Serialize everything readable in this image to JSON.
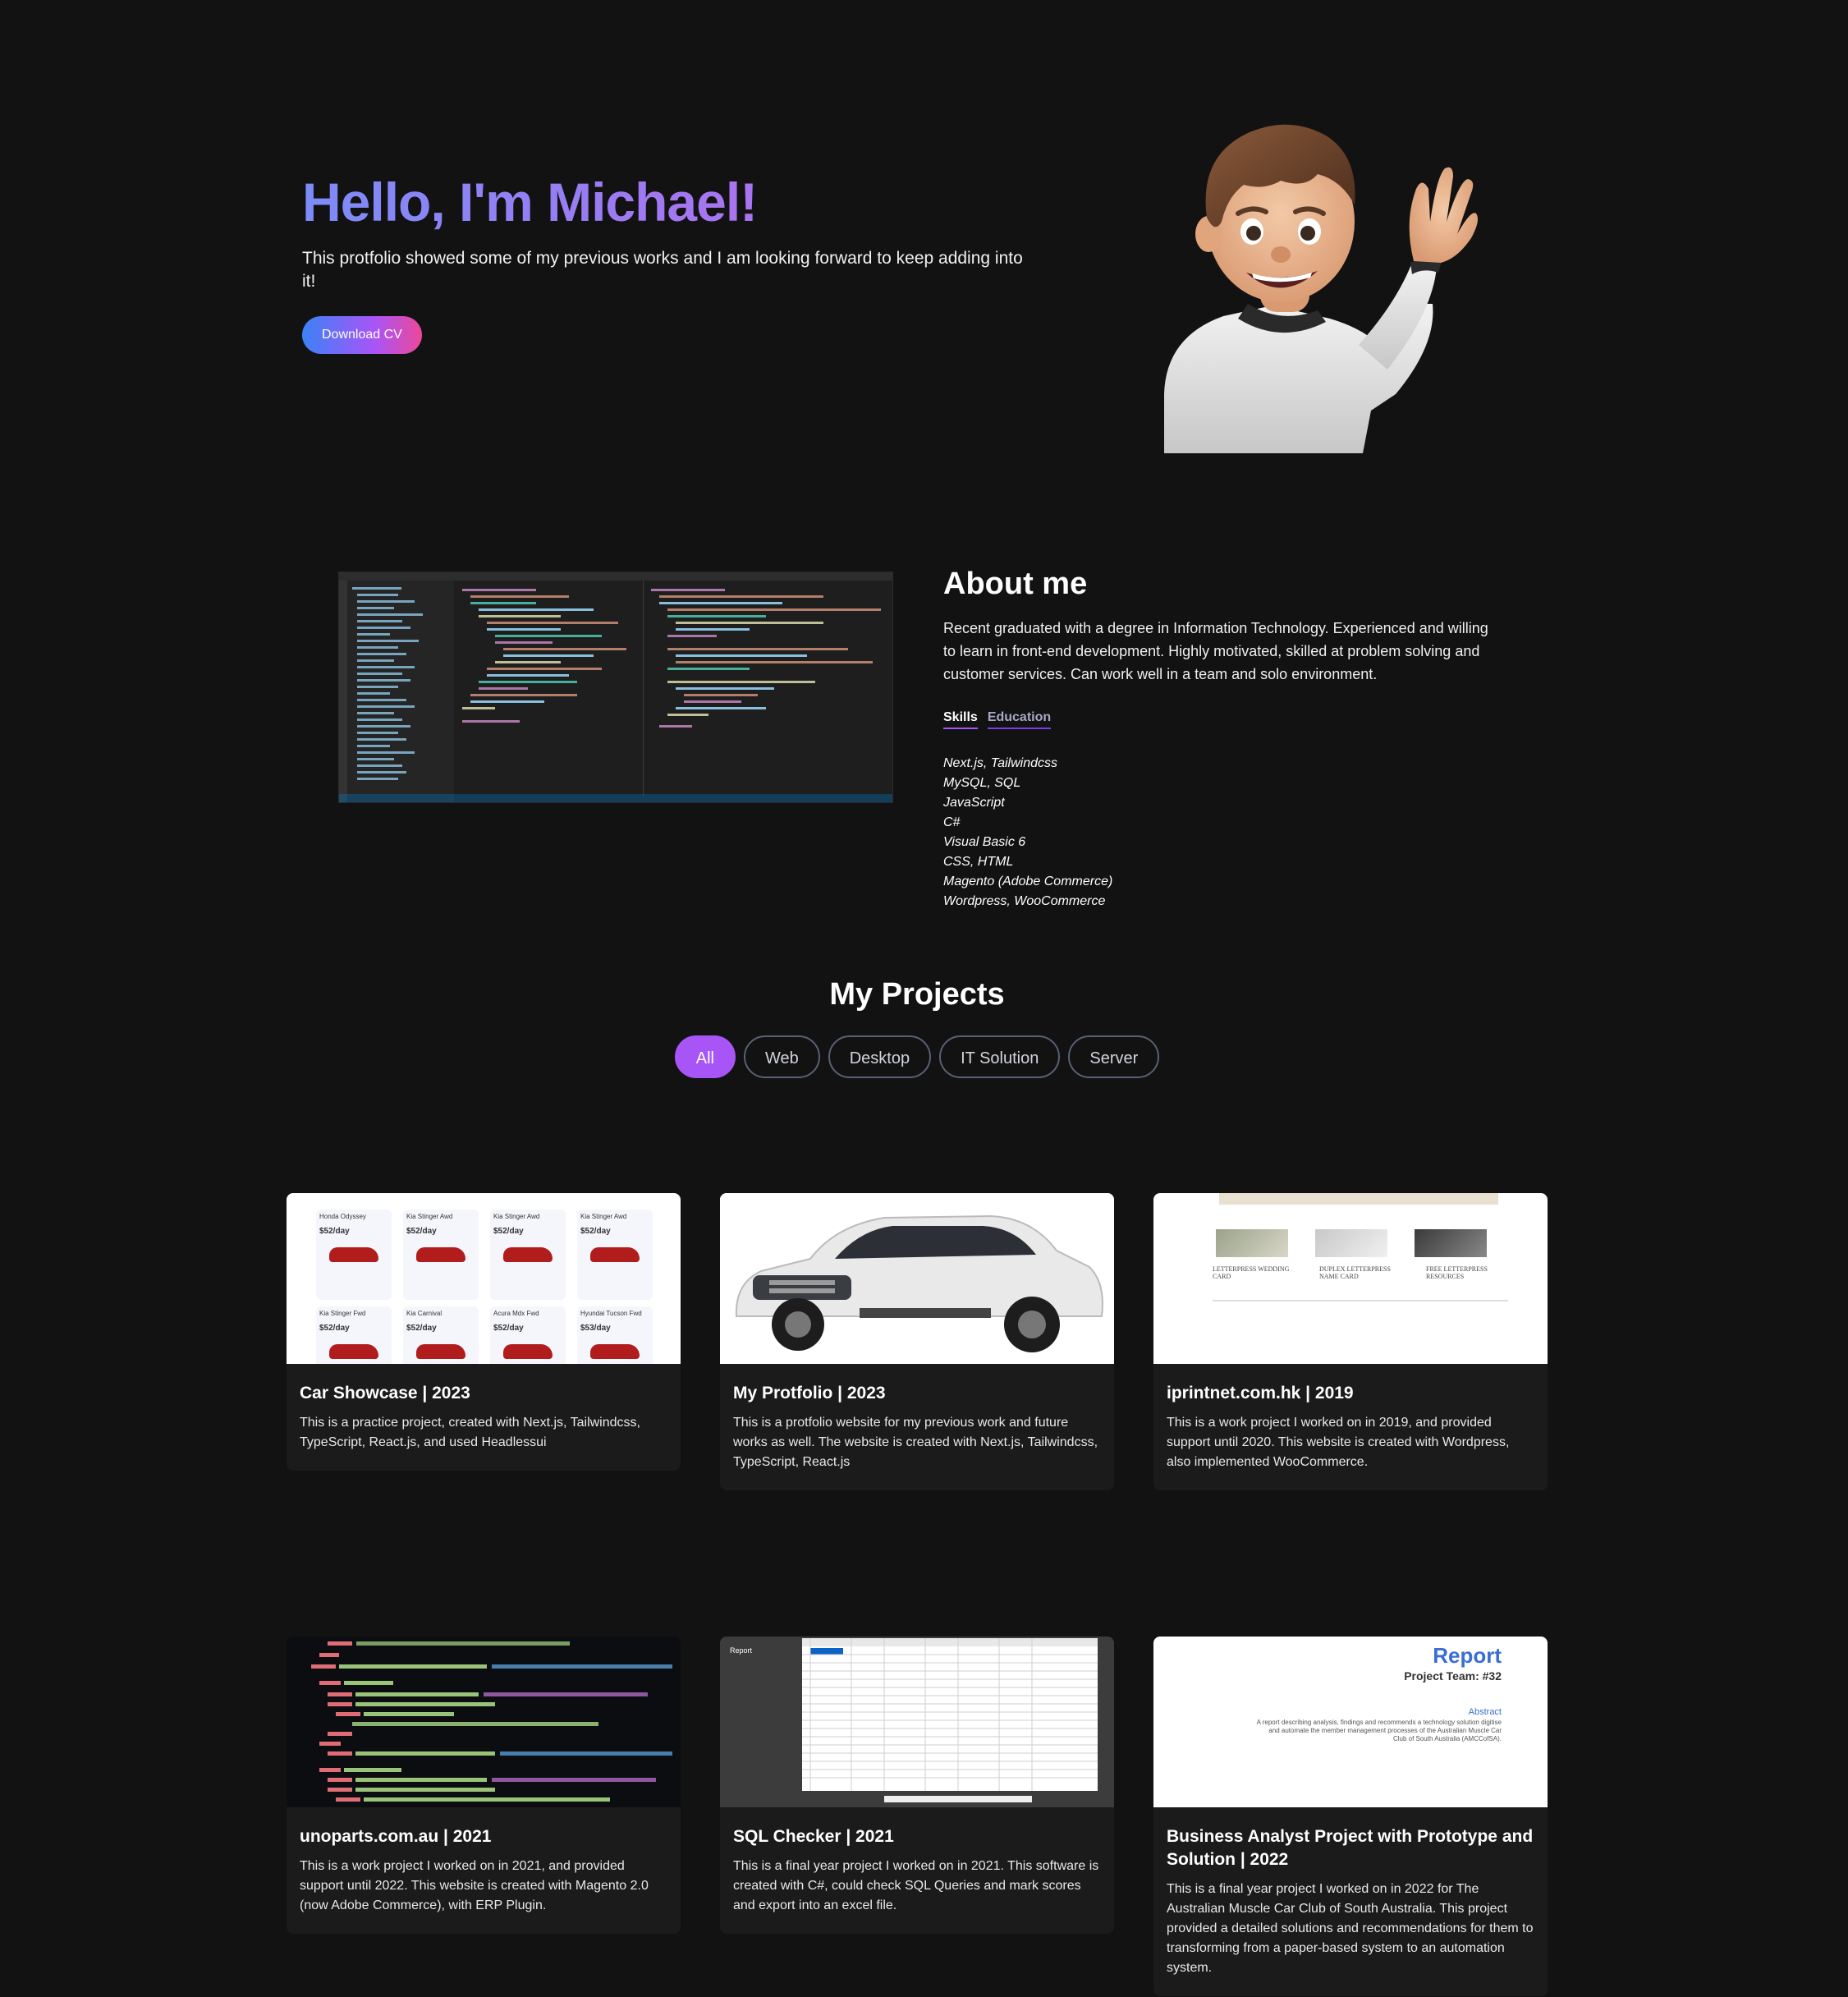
{
  "hero": {
    "title": "Hello, I'm Michael!",
    "description": "This protfolio showed some of my previous works and I am looking forward to keep adding into it!",
    "cta_label": "Download CV"
  },
  "about": {
    "title": "About me",
    "description": "Recent graduated with a degree in Information Technology. Experienced and willing to learn in front-end development. Highly motivated, skilled at problem solving and customer services. Can work well in a team and solo environment.",
    "tabs": [
      "Skills",
      "Education"
    ],
    "skills": [
      "Next.js, Tailwindcss",
      "MySQL, SQL",
      "JavaScript",
      "C#",
      "Visual Basic 6",
      "CSS, HTML",
      "Magento (Adobe Commerce)",
      "Wordpress, WooCommerce"
    ]
  },
  "projects": {
    "title": "My Projects",
    "filters": [
      "All",
      "Web",
      "Desktop",
      "IT Solution",
      "Server"
    ],
    "items": [
      {
        "title": "Car Showcase | 2023",
        "description": "This is a practice project, created with Next.js, Tailwindcss, TypeScript, React.js, and used Headlessui"
      },
      {
        "title": "My Protfolio | 2023",
        "description": "This is a protfolio website for my previous work and future works as well. The website is created with Next.js, Tailwindcss, TypeScript, React.js"
      },
      {
        "title": "iprintnet.com.hk | 2019",
        "description": "This is a work project I worked on in 2019, and provided support until 2020. This website is created with Wordpress, also implemented WooCommerce."
      },
      {
        "title": "unoparts.com.au | 2021",
        "description": "This is a work project I worked on in 2021, and provided support until 2022. This website is created with Magento 2.0 (now Adobe Commerce), with ERP Plugin."
      },
      {
        "title": "SQL Checker | 2021",
        "description": "This is a final year project I worked on in 2021. This software is created with C#, could check SQL Queries and mark scores and export into an excel file."
      },
      {
        "title": "Business Analyst Project with Prototype and Solution | 2022",
        "description": "This is a final year project I worked on in 2022 for The Australian Muscle Car Club of South Australia. This project provided a detailed solutions and recommendations for them to transforming from a paper-based system to an automation system."
      }
    ],
    "thumb_text": {
      "cars": [
        "Honda Odyssey",
        "Kia Stinger Awd",
        "Kia Stinger Awd",
        "Kia Stinger Awd",
        "Kia Stinger Fwd",
        "Kia Carnival",
        "Acura Mdx Fwd",
        "Hyundai Tucson Fwd"
      ],
      "car_prices": [
        "$52/day",
        "$52/day",
        "$52/day",
        "$52/day",
        "$52/day",
        "$52/day",
        "$52/day",
        "$53/day"
      ],
      "print_cols": [
        "LETTERPRESS WEDDING CARD",
        "DUPLEX LETTERPRESS NAME CARD",
        "FREE LETTERPRESS RESOURCES"
      ],
      "report_title": "Report",
      "report_team": "Project Team: #32",
      "report_abstract": "Abstract",
      "report_body": "A report describing analysis, findings and recommends a technology solution digitise and automate the member management processes of the Australian Muscle Car Club of South Australia (AMCCofSA).",
      "sql_side": "Report"
    }
  },
  "colors": {
    "background": "#121212",
    "card": "#1b1b1b",
    "accent": "#a855f7",
    "title_gradient": [
      "#7c8cf8",
      "#c06ee8"
    ]
  }
}
